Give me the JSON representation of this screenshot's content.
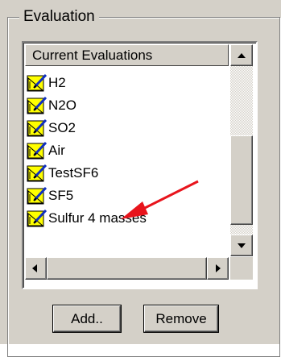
{
  "group": {
    "title": "Evaluation"
  },
  "list": {
    "header": "Current Evaluations",
    "items": [
      {
        "label": "H2",
        "icon": "evaluation-icon"
      },
      {
        "label": "N2O",
        "icon": "evaluation-icon"
      },
      {
        "label": "SO2",
        "icon": "evaluation-icon"
      },
      {
        "label": "Air",
        "icon": "evaluation-icon"
      },
      {
        "label": "TestSF6",
        "icon": "evaluation-icon"
      },
      {
        "label": "SF5",
        "icon": "evaluation-icon"
      },
      {
        "label": "Sulfur 4 masses",
        "icon": "evaluation-icon"
      }
    ]
  },
  "buttons": {
    "add": "Add..",
    "remove": "Remove"
  },
  "colors": {
    "panel": "#d4d0c8",
    "annotation_arrow": "#e8141c",
    "icon_yellow": "#ffff00",
    "icon_blue": "#1030c0"
  }
}
